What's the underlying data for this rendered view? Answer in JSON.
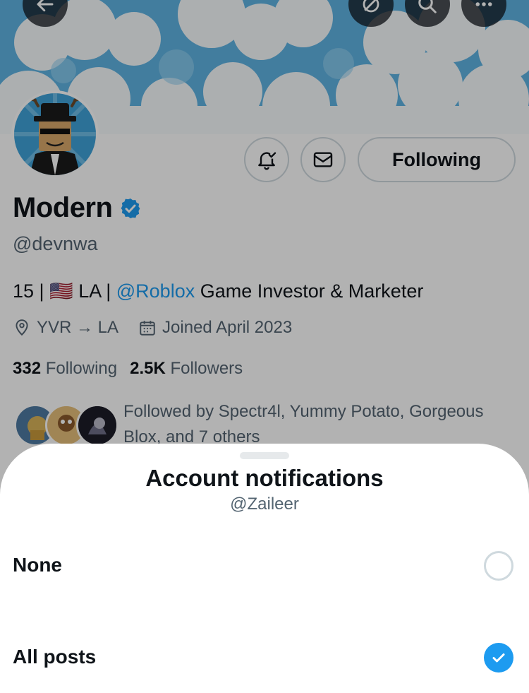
{
  "profile": {
    "display_name": "Modern",
    "handle": "@devnwa",
    "verified": true,
    "bio": {
      "prefix": "15 | ",
      "flag": "🇺🇸",
      "mid": " LA | ",
      "link": "@Roblox",
      "suffix": " Game Investor & Marketer"
    },
    "location": "YVR → LA",
    "joined": "Joined April 2023",
    "following_count": "332",
    "following_label": "Following",
    "followers_count": "2.5K",
    "followers_label": "Followers",
    "followed_by": "Followed by Spectr4l, Yummy Potato, Gorgeous Blox, and 7 others",
    "follow_button_label": "Following"
  },
  "icons": {
    "back": "arrow-left-icon",
    "grok": "grok-icon",
    "search": "search-icon",
    "more": "more-icon",
    "notifications": "bell-check-icon",
    "message": "envelope-icon",
    "location": "location-pin-icon",
    "calendar": "calendar-icon",
    "verified": "verified-badge-icon"
  },
  "colors": {
    "accent": "#1d9bf0",
    "text_primary": "#0f1419",
    "text_secondary": "#536471"
  },
  "sheet": {
    "title": "Account notifications",
    "subtitle": "@Zaileer",
    "options": [
      {
        "label": "None",
        "selected": false
      },
      {
        "label": "All posts",
        "selected": true
      }
    ]
  }
}
